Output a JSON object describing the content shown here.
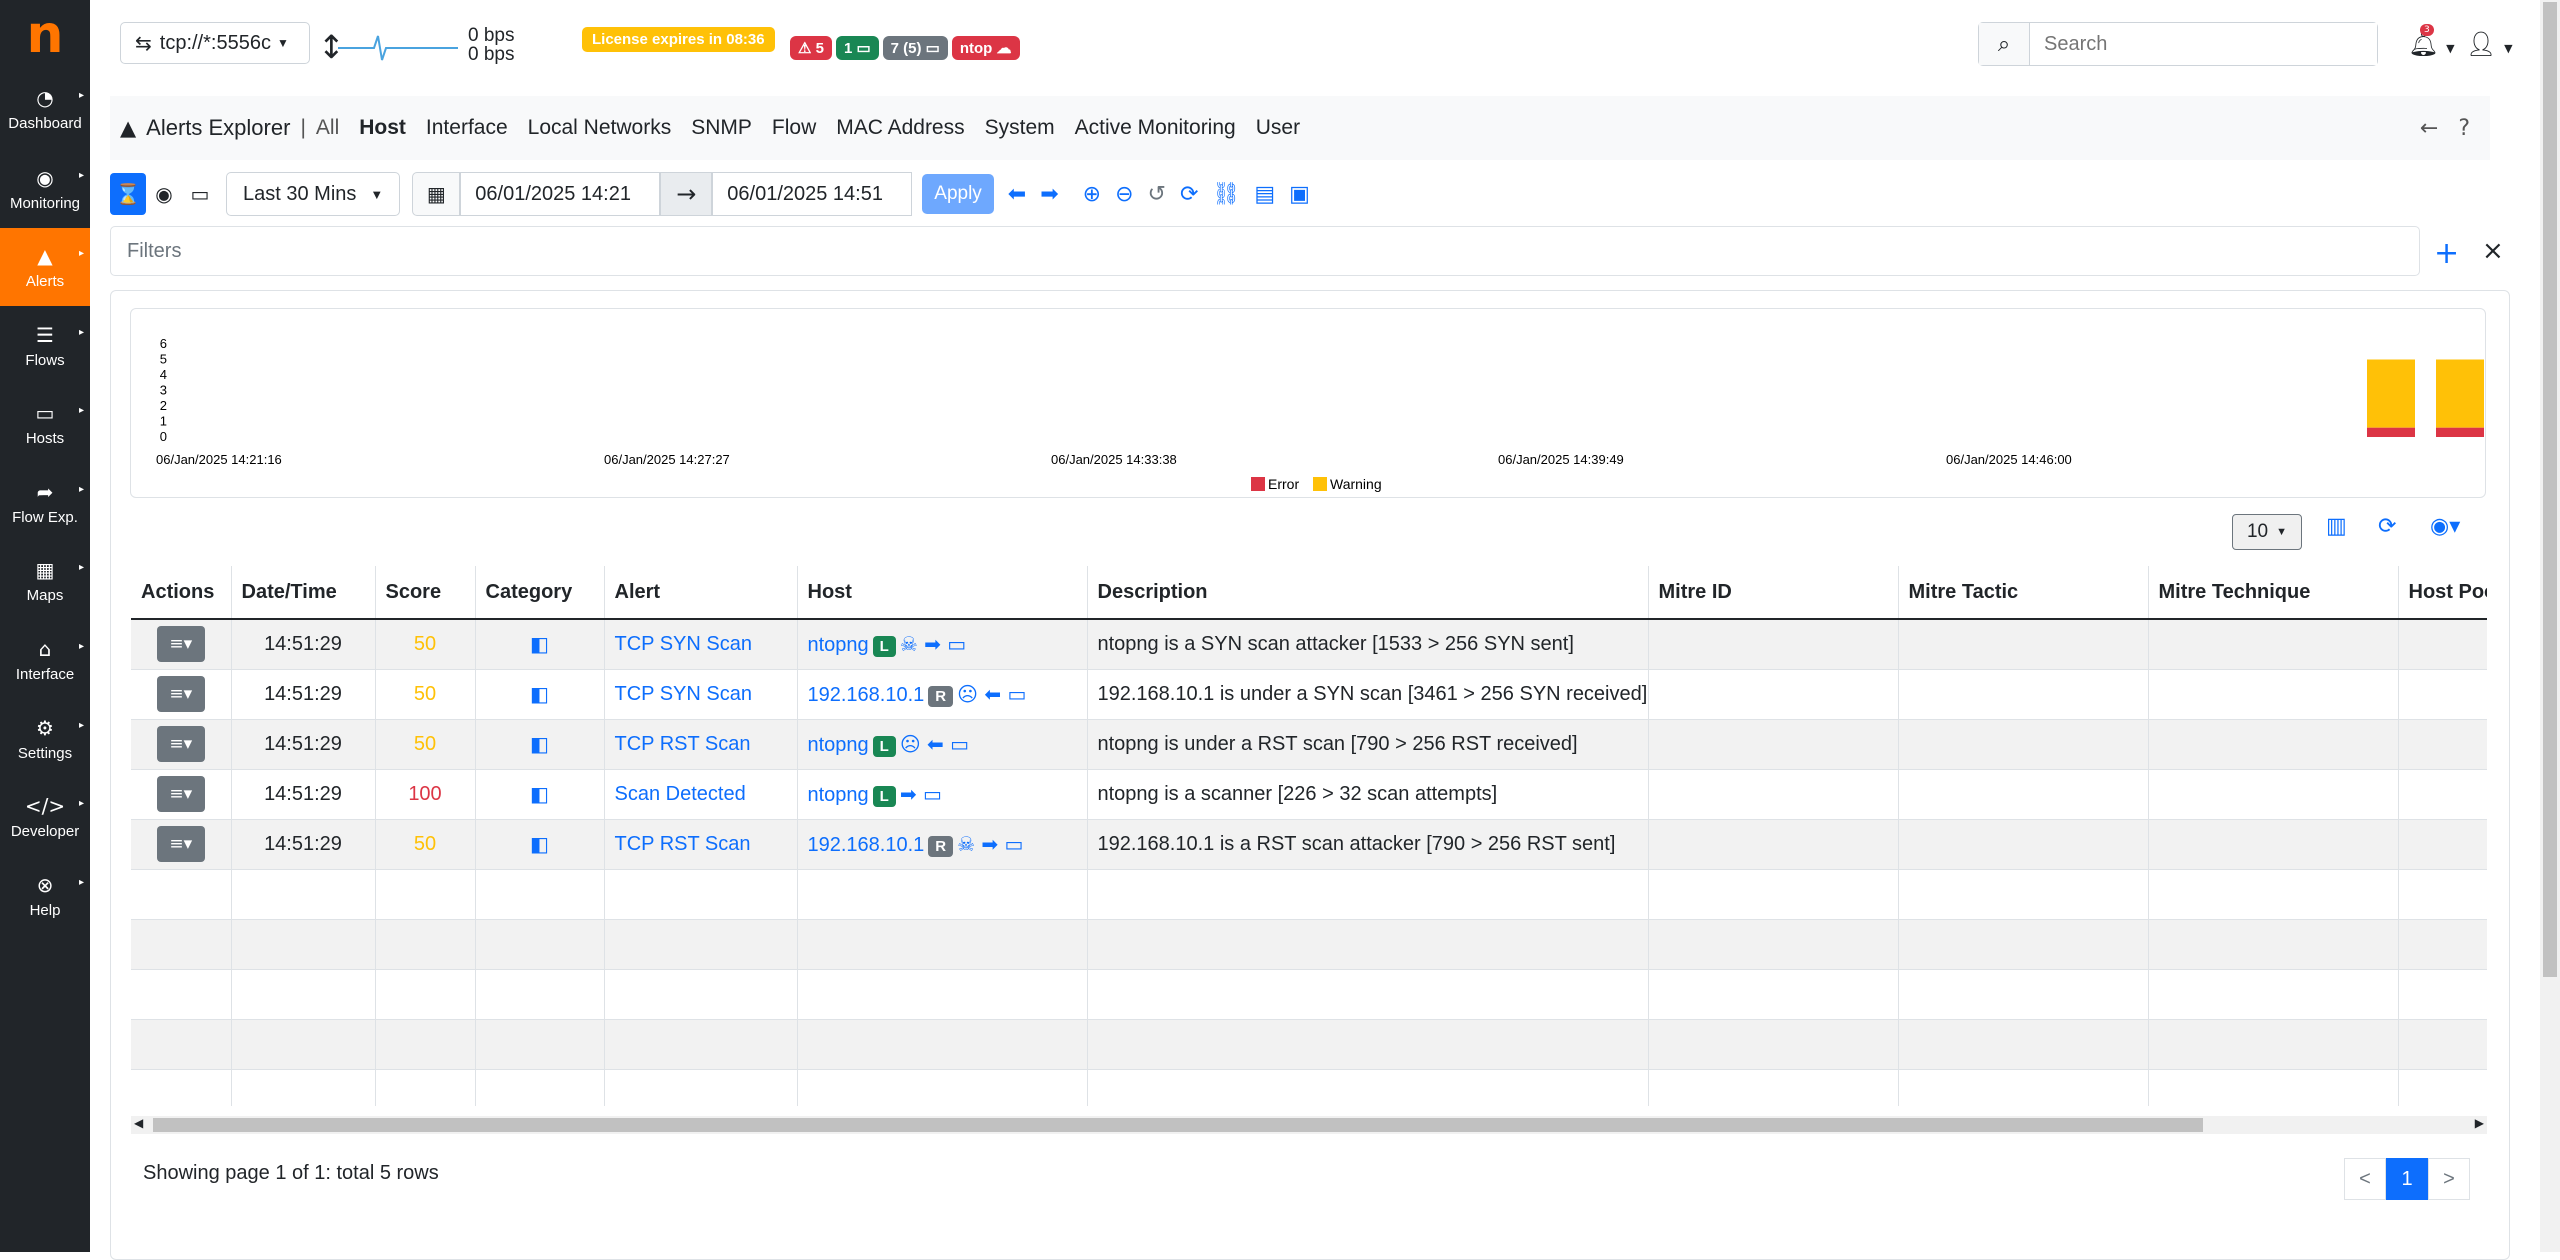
{
  "sidebar": {
    "logo": "n",
    "items": [
      {
        "label": "Dashboard",
        "icon": "gauge-icon",
        "glyph": "◔"
      },
      {
        "label": "Monitoring",
        "icon": "monitoring-icon",
        "glyph": "◉"
      },
      {
        "label": "Alerts",
        "icon": "warning-icon",
        "glyph": "▲"
      },
      {
        "label": "Flows",
        "icon": "flows-icon",
        "glyph": "☰"
      },
      {
        "label": "Hosts",
        "icon": "laptop-icon",
        "glyph": "▭"
      },
      {
        "label": "Flow Exp.",
        "icon": "export-icon",
        "glyph": "➦"
      },
      {
        "label": "Maps",
        "icon": "map-icon",
        "glyph": "▦"
      },
      {
        "label": "Interface",
        "icon": "interface-icon",
        "glyph": "⌂"
      },
      {
        "label": "Settings",
        "icon": "gear-icon",
        "glyph": "⚙"
      },
      {
        "label": "Developer",
        "icon": "code-icon",
        "glyph": "</>"
      },
      {
        "label": "Help",
        "icon": "help-icon",
        "glyph": "⊗"
      }
    ]
  },
  "header": {
    "interface": "tcp://*:5556c",
    "bps_up": "0 bps",
    "bps_down": "0 bps",
    "license": "License expires in 08:36",
    "badge_alerts": "⚠ 5",
    "badge_local": "1 ▭",
    "badge_hosts": "7 (5) ▭",
    "badge_ntop": "ntop ☁",
    "search_placeholder": "Search",
    "notif_count": "3"
  },
  "nav": {
    "title": "Alerts Explorer",
    "all": "All",
    "tabs": [
      "Host",
      "Interface",
      "Local Networks",
      "SNMP",
      "Flow",
      "MAC Address",
      "System",
      "Active Monitoring",
      "User"
    ],
    "active_tab": "Host"
  },
  "toolbar": {
    "range": "Last 30 Mins",
    "from": "06/01/2025 14:21",
    "to": "06/01/2025 14:51",
    "apply": "Apply"
  },
  "filters": {
    "placeholder": "Filters"
  },
  "chart_data": {
    "type": "bar",
    "stacked": true,
    "y_ticks": [
      "0",
      "1",
      "2",
      "3",
      "4",
      "5",
      "6"
    ],
    "ylim": [
      0,
      6
    ],
    "x_labels": [
      "06/Jan/2025 14:21:16",
      "06/Jan/2025 14:27:27",
      "06/Jan/2025 14:33:38",
      "06/Jan/2025 14:39:49",
      "06/Jan/2025 14:46:00"
    ],
    "bars": [
      {
        "position": "near end",
        "error": 1,
        "warning": 4
      },
      {
        "position": "end",
        "error": 1,
        "warning": 4
      }
    ],
    "legend": [
      {
        "name": "Error",
        "color": "#dc3545"
      },
      {
        "name": "Warning",
        "color": "#ffc107"
      }
    ],
    "legend_position": "bottom-center"
  },
  "table": {
    "page_size": "10",
    "columns": [
      "Actions",
      "Date/Time",
      "Score",
      "Category",
      "Alert",
      "Host",
      "Description",
      "Mitre ID",
      "Mitre Tactic",
      "Mitre Technique",
      "Host Poo"
    ],
    "rows": [
      {
        "time": "14:51:29",
        "score": "50",
        "alert": "TCP SYN Scan",
        "host": "ntopng",
        "tag": "L",
        "icons": "☠ ➡ ▭",
        "desc": "ntopng is a SYN scan attacker [1533 > 256 SYN sent]"
      },
      {
        "time": "14:51:29",
        "score": "50",
        "alert": "TCP SYN Scan",
        "host": "192.168.10.1",
        "tag": "R",
        "icons": "☹ ⬅ ▭",
        "desc": "192.168.10.1 is under a SYN scan [3461 > 256 SYN received]"
      },
      {
        "time": "14:51:29",
        "score": "50",
        "alert": "TCP RST Scan",
        "host": "ntopng",
        "tag": "L",
        "icons": "☹ ⬅ ▭",
        "desc": "ntopng is under a RST scan [790 > 256 RST received]"
      },
      {
        "time": "14:51:29",
        "score": "100",
        "alert": "Scan Detected",
        "host": "ntopng",
        "tag": "L",
        "icons": "➡ ▭",
        "desc": "ntopng is a scanner [226 > 32 scan attempts]"
      },
      {
        "time": "14:51:29",
        "score": "50",
        "alert": "TCP RST Scan",
        "host": "192.168.10.1",
        "tag": "R",
        "icons": "☠ ➡ ▭",
        "desc": "192.168.10.1 is a RST scan attacker [790 > 256 RST sent]"
      }
    ],
    "showing": "Showing page 1 of 1: total 5 rows",
    "pager": {
      "prev": "<",
      "current": "1",
      "next": ">"
    }
  }
}
